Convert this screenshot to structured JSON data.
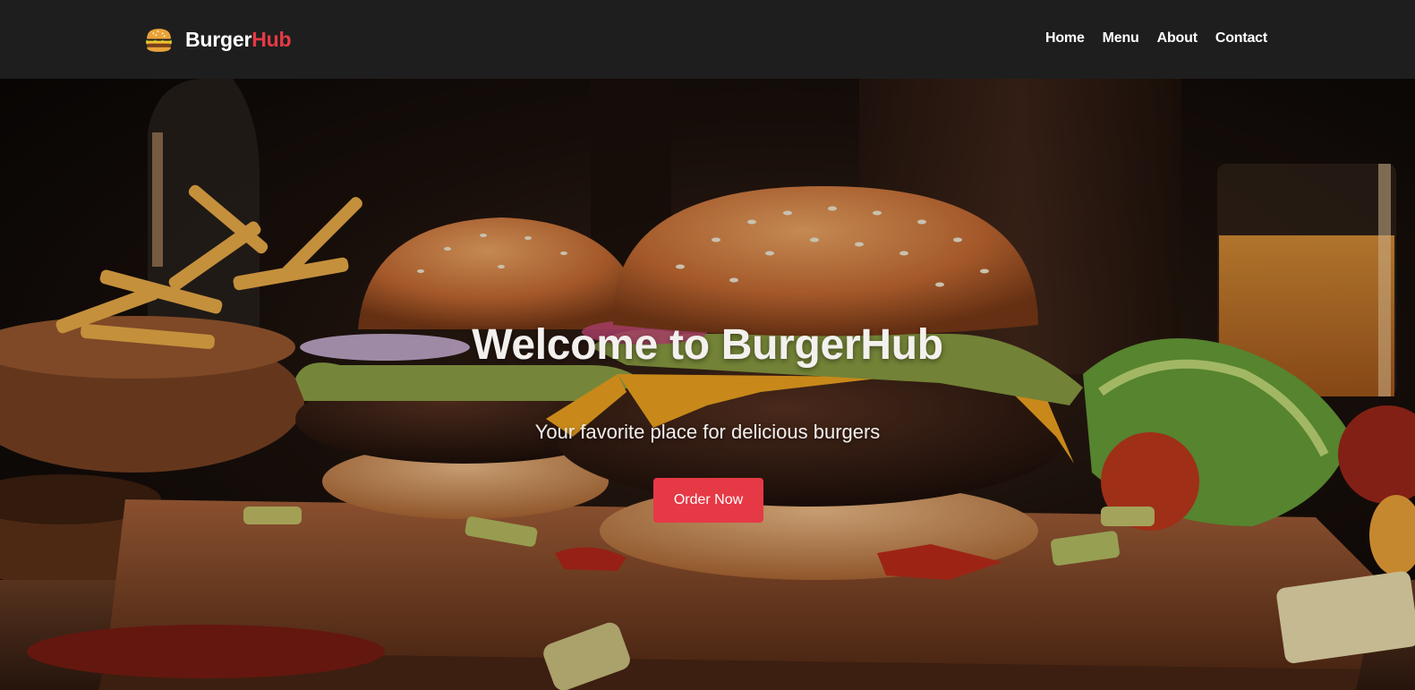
{
  "header": {
    "brand": {
      "part1": "Burger",
      "part2": "Hub",
      "icon": "burger-icon"
    },
    "nav": [
      {
        "label": "Home"
      },
      {
        "label": "Menu"
      },
      {
        "label": "About"
      },
      {
        "label": "Contact"
      }
    ]
  },
  "hero": {
    "title": "Welcome to BurgerHub",
    "subtitle": "Your favorite place for delicious burgers",
    "cta_label": "Order Now",
    "background_image": "burgers-on-wooden-board-photo"
  },
  "colors": {
    "accent": "#e63946",
    "navbar_bg": "#1e1e1e",
    "text_light": "#ffffff"
  }
}
